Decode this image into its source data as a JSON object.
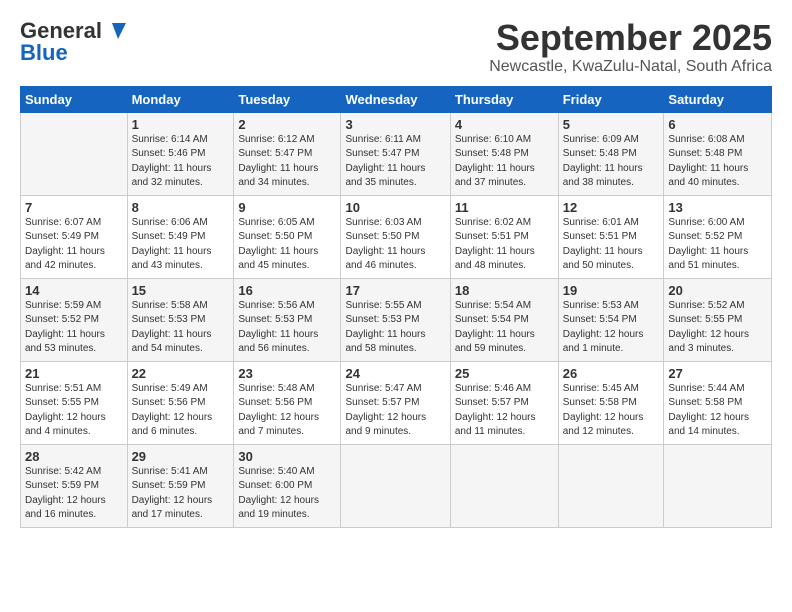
{
  "header": {
    "logo_general": "General",
    "logo_blue": "Blue",
    "month_title": "September 2025",
    "location": "Newcastle, KwaZulu-Natal, South Africa"
  },
  "days_of_week": [
    "Sunday",
    "Monday",
    "Tuesday",
    "Wednesday",
    "Thursday",
    "Friday",
    "Saturday"
  ],
  "weeks": [
    [
      {
        "day": "",
        "info": ""
      },
      {
        "day": "1",
        "info": "Sunrise: 6:14 AM\nSunset: 5:46 PM\nDaylight: 11 hours\nand 32 minutes."
      },
      {
        "day": "2",
        "info": "Sunrise: 6:12 AM\nSunset: 5:47 PM\nDaylight: 11 hours\nand 34 minutes."
      },
      {
        "day": "3",
        "info": "Sunrise: 6:11 AM\nSunset: 5:47 PM\nDaylight: 11 hours\nand 35 minutes."
      },
      {
        "day": "4",
        "info": "Sunrise: 6:10 AM\nSunset: 5:48 PM\nDaylight: 11 hours\nand 37 minutes."
      },
      {
        "day": "5",
        "info": "Sunrise: 6:09 AM\nSunset: 5:48 PM\nDaylight: 11 hours\nand 38 minutes."
      },
      {
        "day": "6",
        "info": "Sunrise: 6:08 AM\nSunset: 5:48 PM\nDaylight: 11 hours\nand 40 minutes."
      }
    ],
    [
      {
        "day": "7",
        "info": "Sunrise: 6:07 AM\nSunset: 5:49 PM\nDaylight: 11 hours\nand 42 minutes."
      },
      {
        "day": "8",
        "info": "Sunrise: 6:06 AM\nSunset: 5:49 PM\nDaylight: 11 hours\nand 43 minutes."
      },
      {
        "day": "9",
        "info": "Sunrise: 6:05 AM\nSunset: 5:50 PM\nDaylight: 11 hours\nand 45 minutes."
      },
      {
        "day": "10",
        "info": "Sunrise: 6:03 AM\nSunset: 5:50 PM\nDaylight: 11 hours\nand 46 minutes."
      },
      {
        "day": "11",
        "info": "Sunrise: 6:02 AM\nSunset: 5:51 PM\nDaylight: 11 hours\nand 48 minutes."
      },
      {
        "day": "12",
        "info": "Sunrise: 6:01 AM\nSunset: 5:51 PM\nDaylight: 11 hours\nand 50 minutes."
      },
      {
        "day": "13",
        "info": "Sunrise: 6:00 AM\nSunset: 5:52 PM\nDaylight: 11 hours\nand 51 minutes."
      }
    ],
    [
      {
        "day": "14",
        "info": "Sunrise: 5:59 AM\nSunset: 5:52 PM\nDaylight: 11 hours\nand 53 minutes."
      },
      {
        "day": "15",
        "info": "Sunrise: 5:58 AM\nSunset: 5:53 PM\nDaylight: 11 hours\nand 54 minutes."
      },
      {
        "day": "16",
        "info": "Sunrise: 5:56 AM\nSunset: 5:53 PM\nDaylight: 11 hours\nand 56 minutes."
      },
      {
        "day": "17",
        "info": "Sunrise: 5:55 AM\nSunset: 5:53 PM\nDaylight: 11 hours\nand 58 minutes."
      },
      {
        "day": "18",
        "info": "Sunrise: 5:54 AM\nSunset: 5:54 PM\nDaylight: 11 hours\nand 59 minutes."
      },
      {
        "day": "19",
        "info": "Sunrise: 5:53 AM\nSunset: 5:54 PM\nDaylight: 12 hours\nand 1 minute."
      },
      {
        "day": "20",
        "info": "Sunrise: 5:52 AM\nSunset: 5:55 PM\nDaylight: 12 hours\nand 3 minutes."
      }
    ],
    [
      {
        "day": "21",
        "info": "Sunrise: 5:51 AM\nSunset: 5:55 PM\nDaylight: 12 hours\nand 4 minutes."
      },
      {
        "day": "22",
        "info": "Sunrise: 5:49 AM\nSunset: 5:56 PM\nDaylight: 12 hours\nand 6 minutes."
      },
      {
        "day": "23",
        "info": "Sunrise: 5:48 AM\nSunset: 5:56 PM\nDaylight: 12 hours\nand 7 minutes."
      },
      {
        "day": "24",
        "info": "Sunrise: 5:47 AM\nSunset: 5:57 PM\nDaylight: 12 hours\nand 9 minutes."
      },
      {
        "day": "25",
        "info": "Sunrise: 5:46 AM\nSunset: 5:57 PM\nDaylight: 12 hours\nand 11 minutes."
      },
      {
        "day": "26",
        "info": "Sunrise: 5:45 AM\nSunset: 5:58 PM\nDaylight: 12 hours\nand 12 minutes."
      },
      {
        "day": "27",
        "info": "Sunrise: 5:44 AM\nSunset: 5:58 PM\nDaylight: 12 hours\nand 14 minutes."
      }
    ],
    [
      {
        "day": "28",
        "info": "Sunrise: 5:42 AM\nSunset: 5:59 PM\nDaylight: 12 hours\nand 16 minutes."
      },
      {
        "day": "29",
        "info": "Sunrise: 5:41 AM\nSunset: 5:59 PM\nDaylight: 12 hours\nand 17 minutes."
      },
      {
        "day": "30",
        "info": "Sunrise: 5:40 AM\nSunset: 6:00 PM\nDaylight: 12 hours\nand 19 minutes."
      },
      {
        "day": "",
        "info": ""
      },
      {
        "day": "",
        "info": ""
      },
      {
        "day": "",
        "info": ""
      },
      {
        "day": "",
        "info": ""
      }
    ]
  ]
}
